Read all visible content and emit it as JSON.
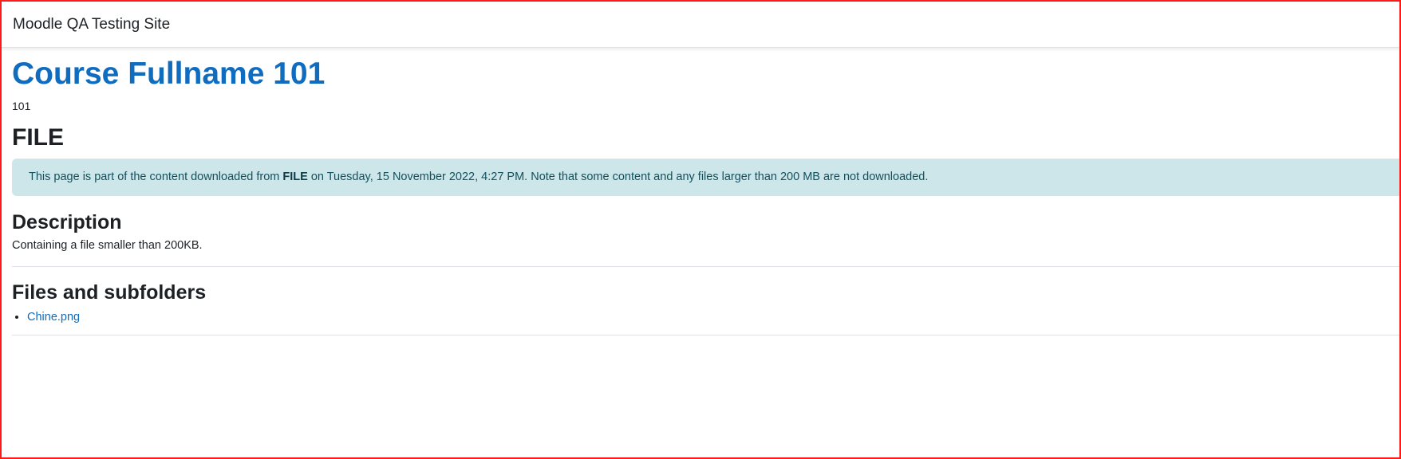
{
  "header": {
    "site_name": "Moodle QA Testing Site"
  },
  "course": {
    "fullname": "Course Fullname 101",
    "shortname": "101"
  },
  "activity": {
    "title": "FILE"
  },
  "notice": {
    "prefix": "This page is part of the content downloaded from ",
    "activity_name": "FILE",
    "suffix": " on Tuesday, 15 November 2022, 4:27 PM. Note that some content and any files larger than 200 MB are not downloaded."
  },
  "description": {
    "heading": "Description",
    "text": "Containing a file smaller than 200KB."
  },
  "files": {
    "heading": "Files and subfolders",
    "items": [
      {
        "name": "Chine.png"
      }
    ]
  },
  "colors": {
    "link": "#0f6cbf",
    "notice_bg": "#cce6ea",
    "notice_text": "#14505c",
    "frame_border": "#ff1a1a"
  }
}
